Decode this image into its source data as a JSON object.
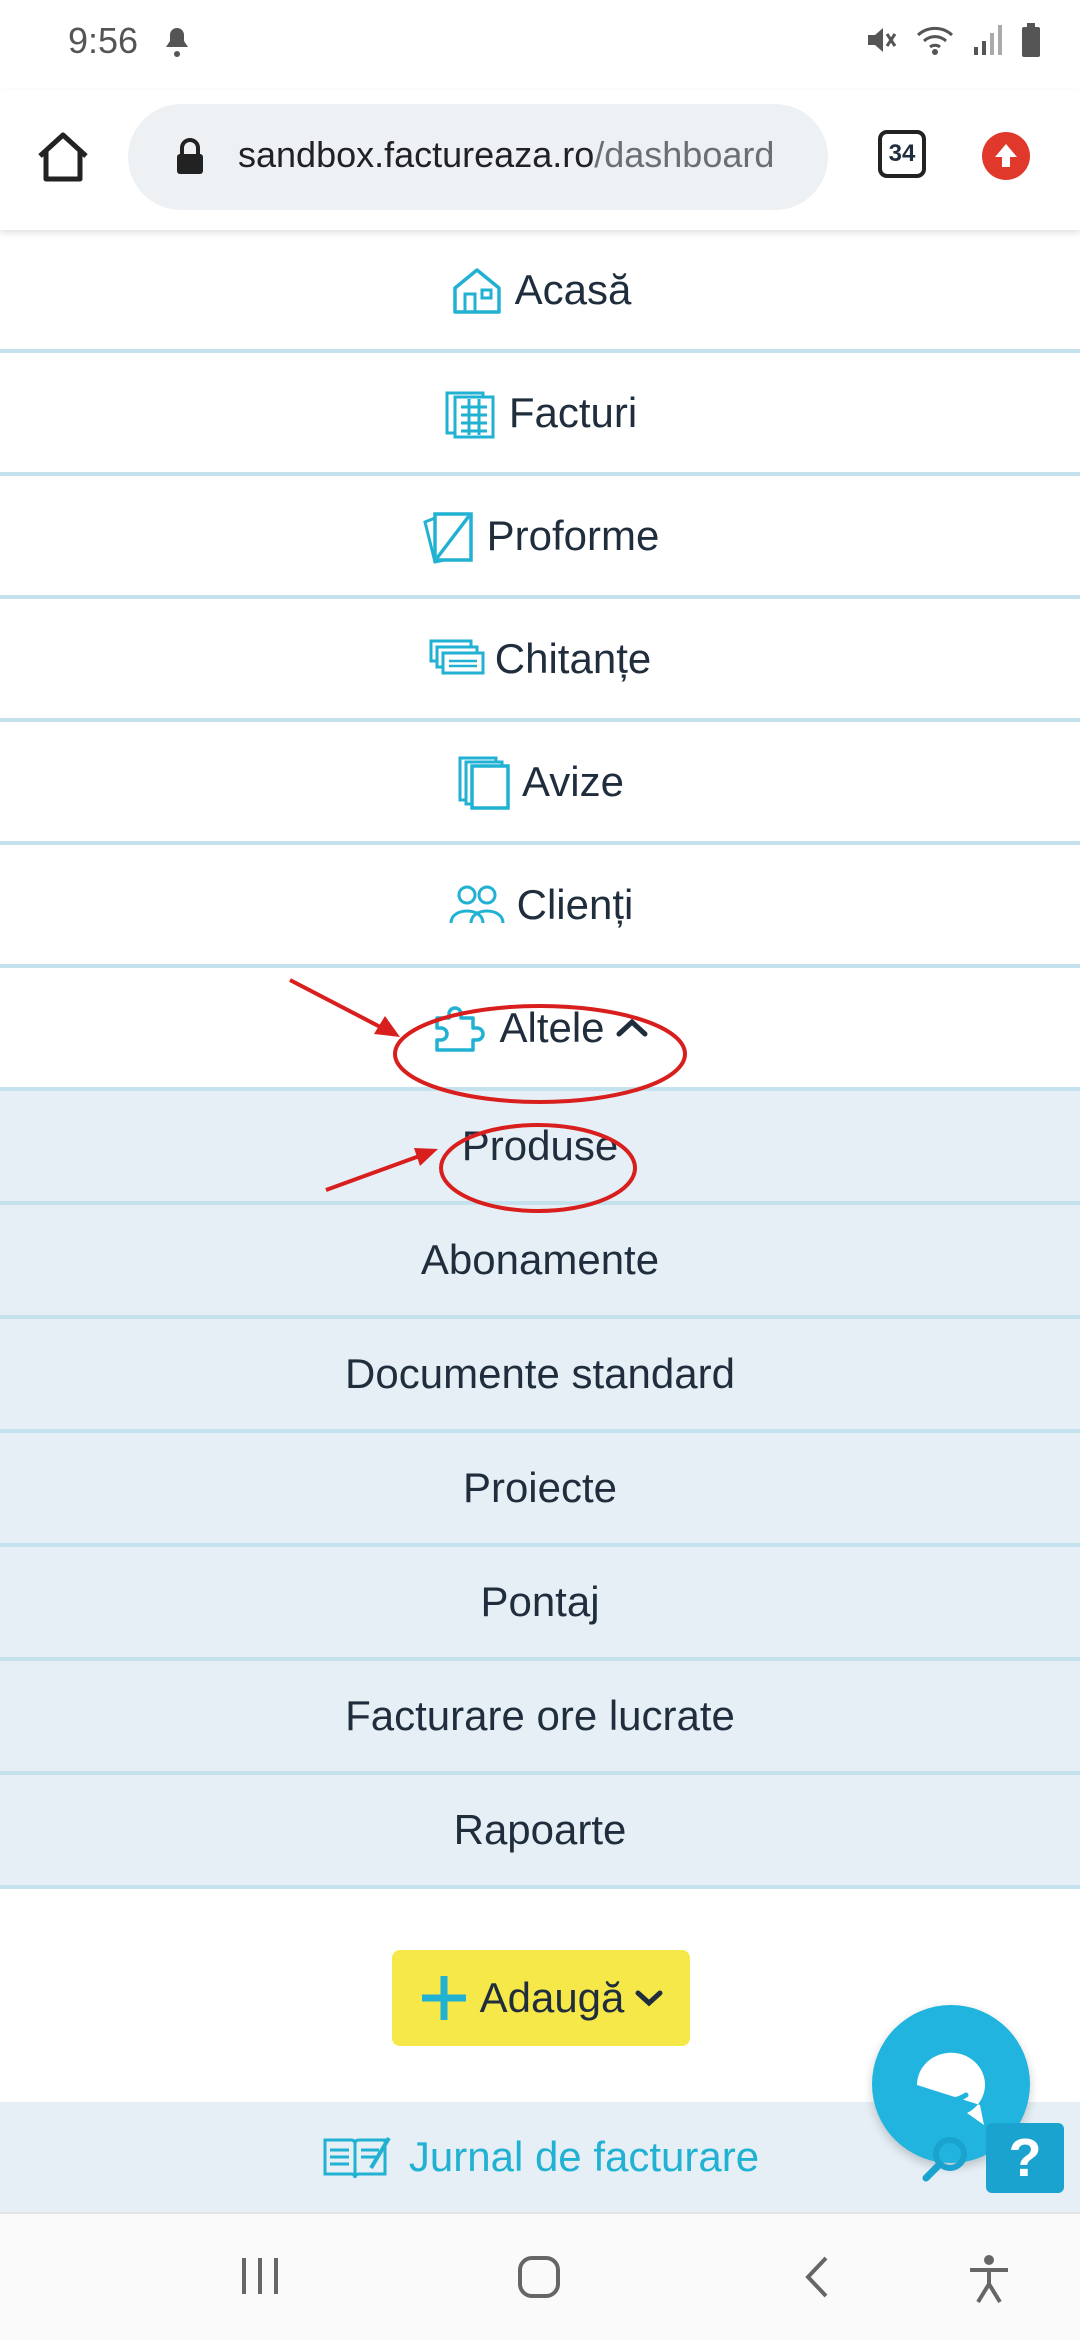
{
  "status_bar": {
    "time": "9:56"
  },
  "browser": {
    "url_host": "sandbox.factureaza.ro",
    "url_path": "/dashboard",
    "tab_count": "34"
  },
  "menu": {
    "items": [
      {
        "label": "Acasă",
        "icon": "house-icon"
      },
      {
        "label": "Facturi",
        "icon": "invoices-icon"
      },
      {
        "label": "Proforme",
        "icon": "proforma-icon"
      },
      {
        "label": "Chitanțe",
        "icon": "receipts-icon"
      },
      {
        "label": "Avize",
        "icon": "notices-icon"
      },
      {
        "label": "Clienți",
        "icon": "clients-icon"
      },
      {
        "label": "Altele",
        "icon": "puzzle-icon"
      }
    ],
    "submenu": [
      "Produse",
      "Abonamente",
      "Documente standard",
      "Proiecte",
      "Pontaj",
      "Facturare ore lucrate",
      "Rapoarte"
    ]
  },
  "add_button": {
    "label": "Adaugă"
  },
  "jurnal": {
    "label": "Jurnal de facturare"
  },
  "help": {
    "label": "?"
  },
  "colors": {
    "accent": "#21b1d3",
    "divider": "#c3e2ee",
    "submenu_bg": "#e5eff5",
    "add_btn": "#f7e84a",
    "annotation": "#d91e1e"
  }
}
